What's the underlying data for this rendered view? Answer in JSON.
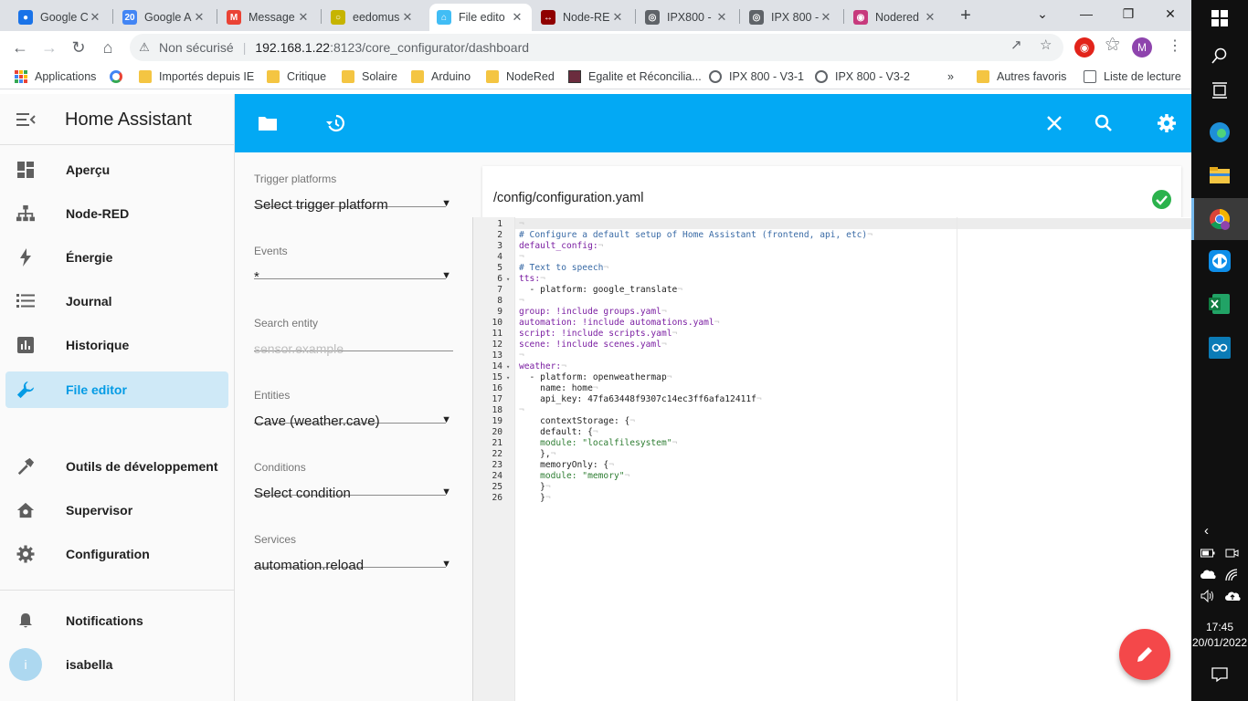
{
  "browser": {
    "tabs": [
      {
        "title": "Google C",
        "icon": "google-account-icon",
        "color": "#1a73e8"
      },
      {
        "title": "Google A",
        "icon": "google-calendar-icon",
        "color": "#4285f4"
      },
      {
        "title": "Message",
        "icon": "gmail-icon",
        "color": "#ea4335"
      },
      {
        "title": "eedomus",
        "icon": "eedomus-icon",
        "color": "#c6b400"
      },
      {
        "title": "File edito",
        "icon": "home-assistant-icon",
        "color": "#41bdf5"
      },
      {
        "title": "Node-RE",
        "icon": "node-red-icon",
        "color": "#8f0000"
      },
      {
        "title": "IPX800 -",
        "icon": "globe-icon",
        "color": "#5f6368"
      },
      {
        "title": "IPX 800 -",
        "icon": "globe-icon",
        "color": "#5f6368"
      },
      {
        "title": "Nodered",
        "icon": "nodered-icon",
        "color": "#c73a7d"
      }
    ],
    "address": {
      "security": "Non sécurisé",
      "host": "192.168.1.22",
      "path": ":8123/core_configurator/dashboard"
    },
    "profile_initial": "M",
    "bookmarks": [
      {
        "label": "Applications",
        "icon": "apps-grid-icon"
      },
      {
        "label": "",
        "icon": "google-icon"
      },
      {
        "label": "Importés depuis IE",
        "icon": "folder-icon"
      },
      {
        "label": "Critique",
        "icon": "folder-icon"
      },
      {
        "label": "Solaire",
        "icon": "folder-icon"
      },
      {
        "label": "Arduino",
        "icon": "folder-icon"
      },
      {
        "label": "NodeRed",
        "icon": "folder-icon"
      },
      {
        "label": "Egalite et Réconcilia...",
        "icon": "egalite-icon"
      },
      {
        "label": "IPX 800 - V3-1",
        "icon": "globe-icon"
      },
      {
        "label": "IPX 800 - V3-2",
        "icon": "globe-icon"
      }
    ],
    "more_bookmarks": "»",
    "other_favorites": "Autres favoris",
    "reading_list": "Liste de lecture"
  },
  "sidebar": {
    "title": "Home Assistant",
    "items": [
      {
        "label": "Aperçu",
        "icon": "dashboard-icon"
      },
      {
        "label": "Node-RED",
        "icon": "sitemap-icon"
      },
      {
        "label": "Énergie",
        "icon": "lightning-icon"
      },
      {
        "label": "Journal",
        "icon": "list-icon"
      },
      {
        "label": "Historique",
        "icon": "chart-box-icon"
      },
      {
        "label": "File editor",
        "icon": "wrench-icon"
      },
      {
        "label": "Outils de développement",
        "icon": "hammer-icon"
      },
      {
        "label": "Supervisor",
        "icon": "home-assistant-supervisor-icon"
      },
      {
        "label": "Configuration",
        "icon": "gear-icon"
      }
    ],
    "notifications": "Notifications",
    "user": {
      "name": "isabella",
      "initial": "i"
    }
  },
  "form": {
    "trigger": {
      "label": "Trigger platforms",
      "value": "Select trigger platform"
    },
    "events": {
      "label": "Events",
      "value": "*"
    },
    "search": {
      "label": "Search entity",
      "placeholder": "sensor.example"
    },
    "entities": {
      "label": "Entities",
      "value": "Cave (weather.cave)"
    },
    "conditions": {
      "label": "Conditions",
      "value": "Select condition"
    },
    "services": {
      "label": "Services",
      "value": "automation.reload"
    }
  },
  "editor": {
    "path": "/config/configuration.yaml",
    "lines": [
      "",
      "# Configure a default setup of Home Assistant (frontend, api, etc)",
      "default_config:",
      "",
      "# Text to speech",
      "tts:",
      "  - platform: google_translate",
      "",
      "group: !include groups.yaml",
      "automation: !include automations.yaml",
      "script: !include scripts.yaml",
      "scene: !include scenes.yaml",
      "",
      "weather:",
      "  - platform: openweathermap",
      "    name: home",
      "    api_key: 47fa63448f9307c14ec3ff6afa12411f",
      "",
      "    contextStorage: {",
      "    default: {",
      "    module: \"localfilesystem\"",
      "    },",
      "    memoryOnly: {",
      "    module: \"memory\"",
      "    }",
      "    }"
    ]
  },
  "taskbar": {
    "time": "17:45",
    "date": "20/01/2022"
  },
  "colors": {
    "primary": "#03a9f4",
    "fab": "#f4484a",
    "valid": "#2bb24c"
  }
}
